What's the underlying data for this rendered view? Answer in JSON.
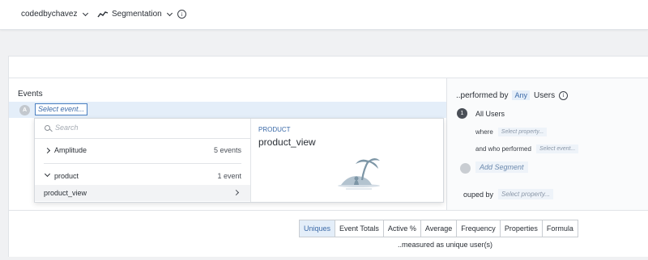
{
  "topbar": {
    "project": "codedbychavez",
    "chart_type": "Segmentation",
    "info_icon": "info-icon"
  },
  "events": {
    "title": "Events",
    "badge": "A",
    "select_placeholder": "Select event..."
  },
  "picker": {
    "search_placeholder": "Search",
    "groups": [
      {
        "name": "Amplitude",
        "count": "5 events",
        "expanded": false
      },
      {
        "name": "product",
        "count": "1 event",
        "expanded": true
      }
    ],
    "items": [
      {
        "name": "product_view"
      }
    ],
    "preview": {
      "category": "PRODUCT",
      "event": "product_view",
      "illustration": "island-palm-tree"
    }
  },
  "segment": {
    "performed_prefix": "..performed by",
    "any": "Any",
    "users": "Users",
    "badge": "1",
    "all_users": "All Users",
    "where_label": "where",
    "where_chip": "Select property...",
    "who_label": "and who performed",
    "who_chip": "Select event...",
    "add_segment": "Add Segment",
    "grouped_label": "ouped by",
    "grouped_chip": "Select property..."
  },
  "measure": {
    "tabs": [
      "Uniques",
      "Event Totals",
      "Active %",
      "Average",
      "Frequency",
      "Properties",
      "Formula"
    ],
    "active_tab": "Uniques",
    "caption": "..measured as unique user(s)"
  },
  "colors": {
    "accent": "#3b6aa8",
    "highlight": "#e4eef9"
  }
}
